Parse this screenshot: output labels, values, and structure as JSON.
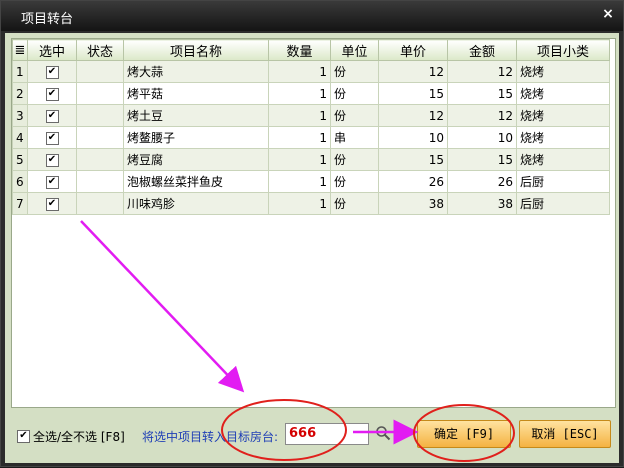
{
  "window": {
    "title": "项目转台",
    "close_glyph": "×"
  },
  "table": {
    "headers": [
      "选中",
      "状态",
      "项目名称",
      "数量",
      "单位",
      "单价",
      "金额",
      "项目小类"
    ],
    "rows": [
      {
        "idx": "1",
        "checked": "✔",
        "status": "",
        "name": "烤大蒜",
        "qty": "1",
        "unit": "份",
        "price": "12",
        "amount": "12",
        "category": "烧烤"
      },
      {
        "idx": "2",
        "checked": "✔",
        "status": "",
        "name": "烤平菇",
        "qty": "1",
        "unit": "份",
        "price": "15",
        "amount": "15",
        "category": "烧烤"
      },
      {
        "idx": "3",
        "checked": "✔",
        "status": "",
        "name": "烤土豆",
        "qty": "1",
        "unit": "份",
        "price": "12",
        "amount": "12",
        "category": "烧烤"
      },
      {
        "idx": "4",
        "checked": "✔",
        "status": "",
        "name": "烤鳌腰子",
        "qty": "1",
        "unit": "串",
        "price": "10",
        "amount": "10",
        "category": "烧烤"
      },
      {
        "idx": "5",
        "checked": "✔",
        "status": "",
        "name": "烤豆腐",
        "qty": "1",
        "unit": "份",
        "price": "15",
        "amount": "15",
        "category": "烧烤"
      },
      {
        "idx": "6",
        "checked": "✔",
        "status": "",
        "name": "泡椒螺丝菜拌鱼皮",
        "qty": "1",
        "unit": "份",
        "price": "26",
        "amount": "26",
        "category": "后厨"
      },
      {
        "idx": "7",
        "checked": "✔",
        "status": "",
        "name": "川味鸡胗",
        "qty": "1",
        "unit": "份",
        "price": "38",
        "amount": "38",
        "category": "后厨"
      }
    ]
  },
  "footer": {
    "select_all_check": "✔",
    "select_all_label": "全选/全不选 [F8]",
    "transfer_label": "将选中项目转入目标房台:",
    "room_value": "666",
    "ok_label": "确定 [F9]",
    "cancel_label": "取消 [ESC]"
  },
  "colors": {
    "annotation": "#e21cf2",
    "circle": "#e0201c",
    "accent_blue": "#1f3fb6"
  }
}
